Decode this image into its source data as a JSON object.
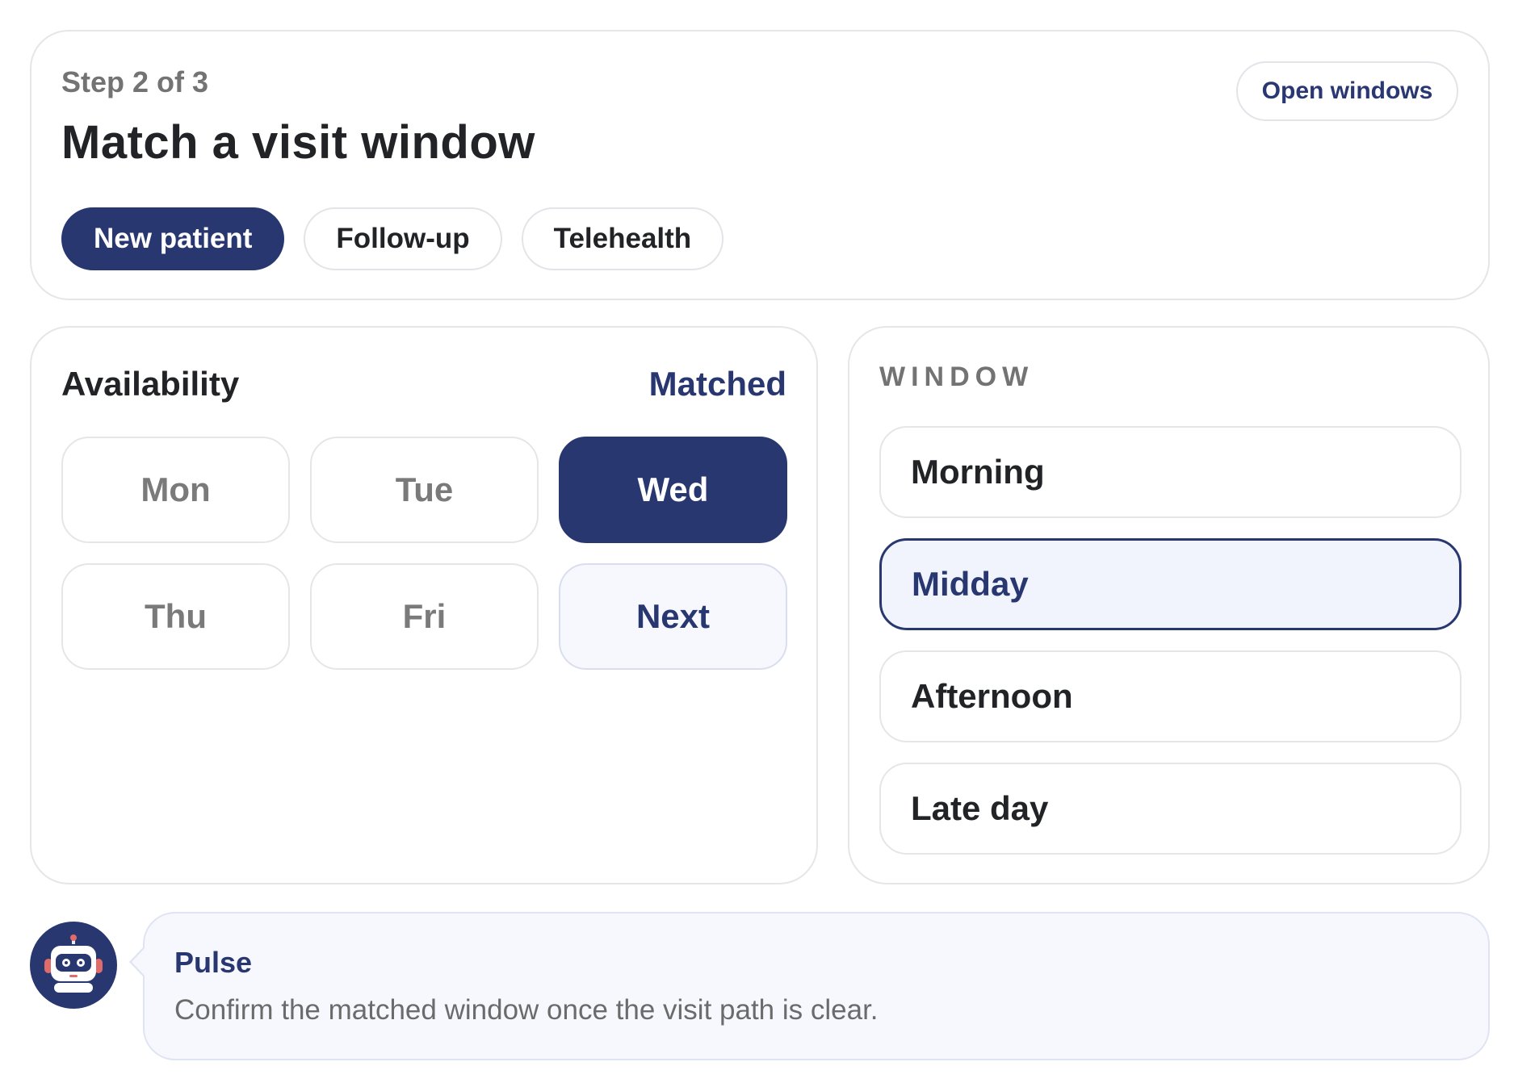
{
  "header": {
    "step_label": "Step 2 of 3",
    "title": "Match a visit window",
    "open_windows_label": "Open windows",
    "visit_types": [
      {
        "label": "New patient",
        "active": true
      },
      {
        "label": "Follow-up",
        "active": false
      },
      {
        "label": "Telehealth",
        "active": false
      }
    ]
  },
  "availability": {
    "title": "Availability",
    "status": "Matched",
    "days": [
      {
        "label": "Mon",
        "state": "default"
      },
      {
        "label": "Tue",
        "state": "default"
      },
      {
        "label": "Wed",
        "state": "selected"
      },
      {
        "label": "Thu",
        "state": "default"
      },
      {
        "label": "Fri",
        "state": "default"
      },
      {
        "label": "Next",
        "state": "next"
      }
    ]
  },
  "window": {
    "heading": "WINDOW",
    "slots": [
      {
        "label": "Morning",
        "selected": false
      },
      {
        "label": "Midday",
        "selected": true
      },
      {
        "label": "Afternoon",
        "selected": false
      },
      {
        "label": "Late day",
        "selected": false
      }
    ]
  },
  "assistant": {
    "avatar_icon": "robot-icon",
    "name": "Pulse",
    "message": "Confirm the matched window once the visit path is clear."
  },
  "colors": {
    "accent": "#283770",
    "selected_fill": "#f1f4fd",
    "bubble_bg": "#f6f8fe",
    "muted_text": "#737373"
  }
}
